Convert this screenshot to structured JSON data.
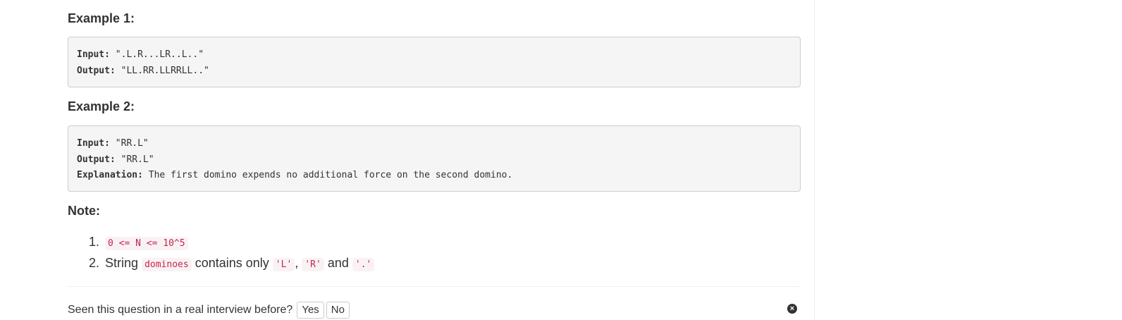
{
  "example1": {
    "heading": "Example 1:",
    "input_key": "Input:",
    "input_value": " \".L.R...LR..L..\"",
    "output_key": "Output:",
    "output_value": " \"LL.RR.LLRRLL..\""
  },
  "example2": {
    "heading": "Example 2:",
    "input_key": "Input:",
    "input_value": " \"RR.L\"",
    "output_key": "Output:",
    "output_value": " \"RR.L\"",
    "explanation_key": "Explanation:",
    "explanation_value": " The first domino expends no additional force on the second domino."
  },
  "note": {
    "heading": "Note:",
    "items": [
      {
        "number": "1.",
        "code": "0 <= N <= 10^5"
      },
      {
        "number": "2.",
        "text_before": "String",
        "code1": "dominoes",
        "text_mid": "contains only",
        "code2": "'L'",
        "comma": ",",
        "code3": "'R'",
        "and": "and",
        "code4": "'.'"
      }
    ]
  },
  "feedback": {
    "question": "Seen this question in a real interview before?",
    "yes": "Yes",
    "no": "No",
    "close_icon": "×"
  }
}
